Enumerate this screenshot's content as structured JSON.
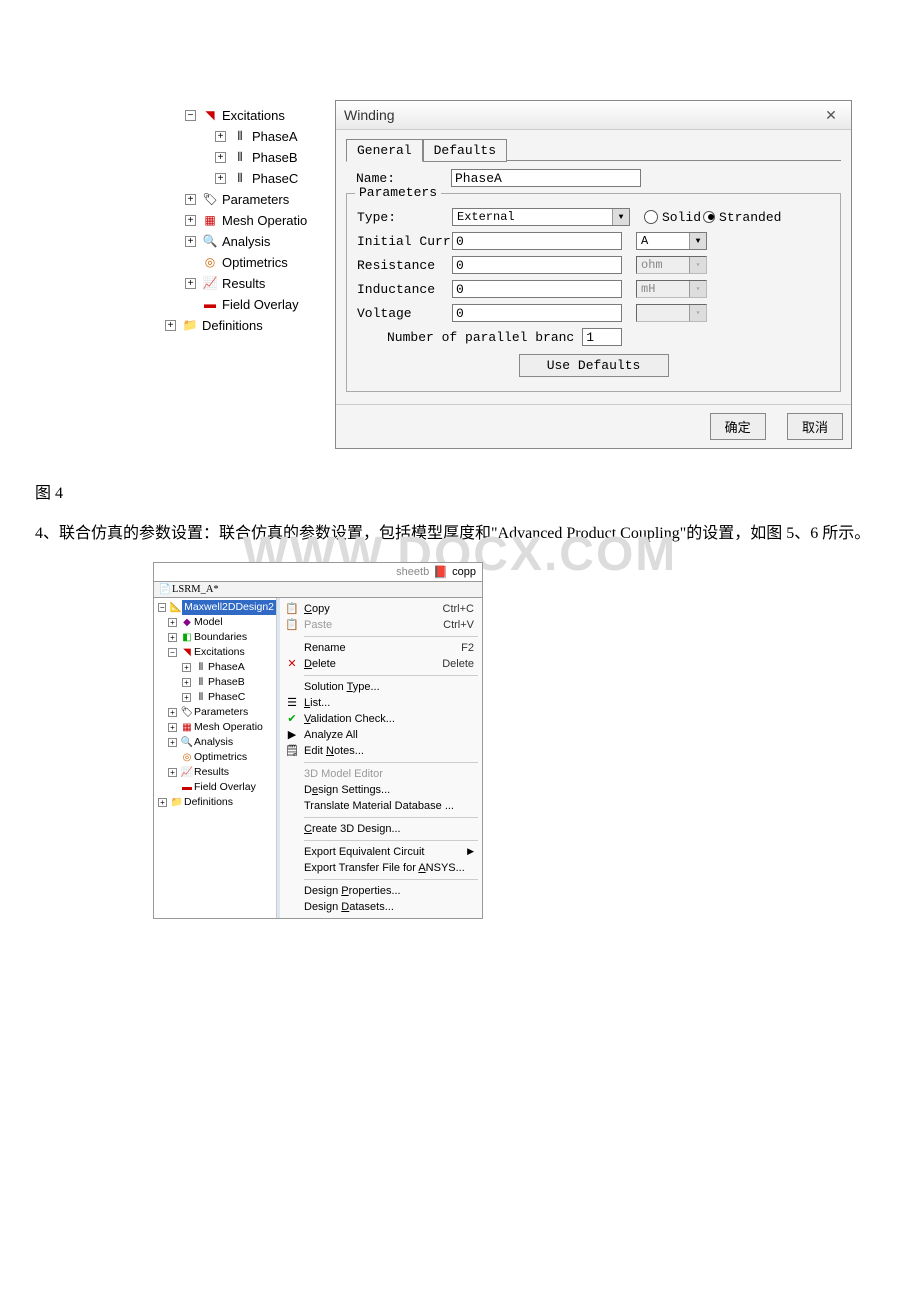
{
  "tree1": {
    "excitations": "Excitations",
    "phaseA": "PhaseA",
    "phaseB": "PhaseB",
    "phaseC": "PhaseC",
    "parameters": "Parameters",
    "meshOperations": "Mesh Operatio",
    "analysis": "Analysis",
    "optimetrics": "Optimetrics",
    "results": "Results",
    "fieldOverlays": "Field Overlay",
    "definitions": "Definitions"
  },
  "winding": {
    "title": "Winding",
    "tab_general": "General",
    "tab_defaults": "Defaults",
    "name_label": "Name:",
    "name_value": "PhaseA",
    "params_legend": "Parameters",
    "type_label": "Type:",
    "type_value": "External",
    "radio_solid": "Solid",
    "radio_stranded": "Stranded",
    "init_label": "Initial Curr",
    "init_value": "0",
    "init_unit": "A",
    "res_label": "Resistance",
    "res_value": "0",
    "res_unit": "ohm",
    "ind_label": "Inductance",
    "ind_value": "0",
    "ind_unit": "mH",
    "vol_label": "Voltage",
    "vol_value": "0",
    "vol_unit": "",
    "branch_label": "Number of parallel branc",
    "branch_value": "1",
    "use_defaults": "Use Defaults",
    "ok": "确定",
    "cancel": "取消"
  },
  "caption_fig4": "图 4",
  "paragraph1": "4、联合仿真的参数设置：联合仿真的参数设置，包括模型厚度和\"Advanced Product Coupling\"的设置，如图 5、6 所示。",
  "watermark": "WWW.DOCX.COM",
  "fig2": {
    "topbar_word": "sheetb",
    "topbar_right": "copp",
    "project": "LSRM_A*",
    "design": "Maxwell2DDesign2",
    "tree": {
      "model": "Model",
      "boundaries": "Boundaries",
      "excitations": "Excitations",
      "phaseA": "PhaseA",
      "phaseB": "PhaseB",
      "phaseC": "PhaseC",
      "parameters": "Parameters",
      "meshOperations": "Mesh Operatio",
      "analysis": "Analysis",
      "optimetrics": "Optimetrics",
      "results": "Results",
      "fieldOverlays": "Field Overlay",
      "definitions": "Definitions"
    },
    "menu": {
      "copy": "Copy",
      "copy_sc": "Ctrl+C",
      "paste": "Paste",
      "paste_sc": "Ctrl+V",
      "rename": "Rename",
      "rename_sc": "F2",
      "delete": "Delete",
      "delete_sc": "Delete",
      "solutionType": "Solution Type...",
      "list": "List...",
      "validationCheck": "Validation Check...",
      "analyzeAll": "Analyze All",
      "editNotes": "Edit Notes...",
      "modelEditor": "3D Model Editor",
      "designSettings": "Design Settings...",
      "translateDB": "Translate Material Database ...",
      "create3D": "Create 3D Design...",
      "exportCircuit": "Export Equivalent Circuit",
      "exportAnsys": "Export Transfer File for ANSYS...",
      "designProps": "Design Properties...",
      "designDatasets": "Design Datasets..."
    }
  }
}
